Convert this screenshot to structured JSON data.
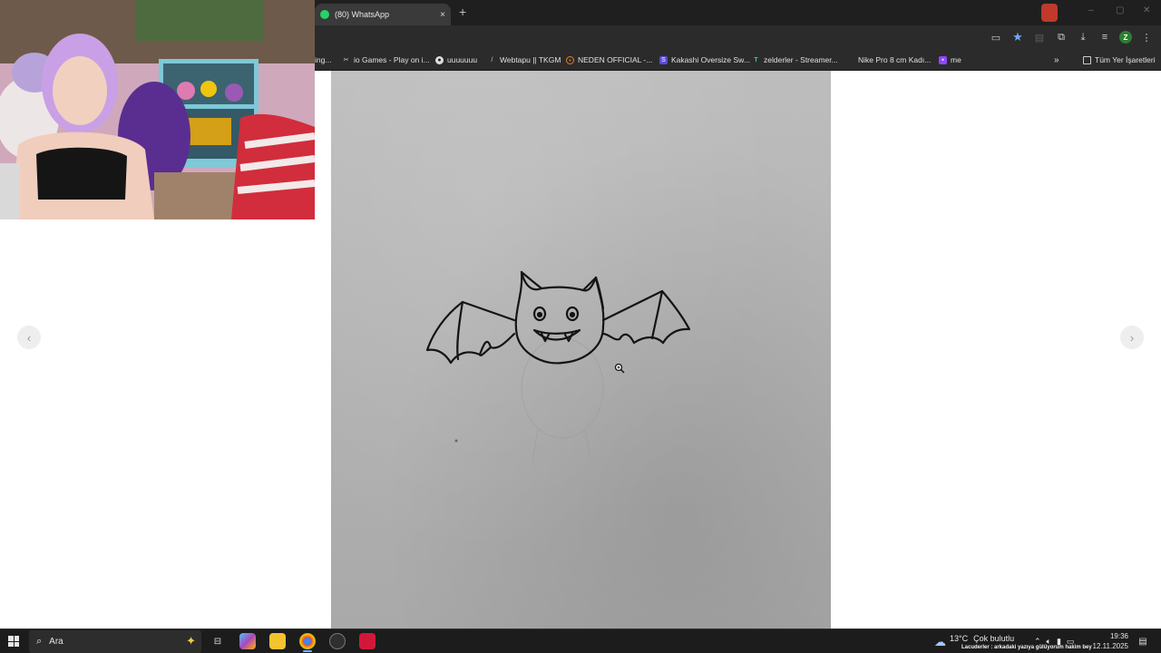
{
  "browser": {
    "tab": {
      "title": "(80) WhatsApp",
      "favicon": "whatsapp-icon",
      "close": "×"
    },
    "new_tab": "+",
    "toolbar_icons": [
      "cast-icon",
      "bookmark-star-icon",
      "reading-list-icon",
      "extensions-icon",
      "download-icon",
      "media-control-icon",
      "profile-avatar-icon",
      "menu-dots-icon"
    ],
    "profile_initial": "Z",
    "bookmarks": [
      {
        "label": "ing...",
        "icon": "bookmark-icon"
      },
      {
        "label": "io Games - Play on i...",
        "icon": "io-games-icon"
      },
      {
        "label": "uuuuuuu",
        "icon": "github-icon"
      },
      {
        "label": "Webtapu || TKGM",
        "icon": "webtapu-icon"
      },
      {
        "label": "NEDEN OFFICIAL -...",
        "icon": "neden-icon"
      },
      {
        "label": "Kakashi Oversize Sw...",
        "icon": "shopier-icon"
      },
      {
        "label": "zelderler - Streamer...",
        "icon": "tt-icon"
      },
      {
        "label": "Nike Pro 8 cm Kadı...",
        "icon": "nike-icon"
      },
      {
        "label": "me",
        "icon": "twitch-icon"
      }
    ],
    "more_bookmarks": "»",
    "all_bookmarks": "Tüm Yer İşaretleri"
  },
  "viewer": {
    "prev": "‹",
    "next": "›",
    "image_subject": "bat-drawing",
    "cursor": "zoom-in-icon"
  },
  "taskbar": {
    "search_placeholder": "Ara",
    "apps": [
      "task-view-icon",
      "copilot-icon",
      "file-explorer-icon",
      "chrome-icon",
      "obs-icon",
      "opera-gx-icon"
    ],
    "weather_temp": "13°C",
    "weather_desc": "Çok bulutlu",
    "ticker": "Lacuderler : arkadaki yazıya gülüyorum hakim bey",
    "time": "19:36",
    "date": "12.11.2025"
  },
  "colors": {
    "chrome_dark": "#1f1f1f",
    "accent_blue": "#6ea8ff",
    "whatsapp_green": "#25d366"
  }
}
